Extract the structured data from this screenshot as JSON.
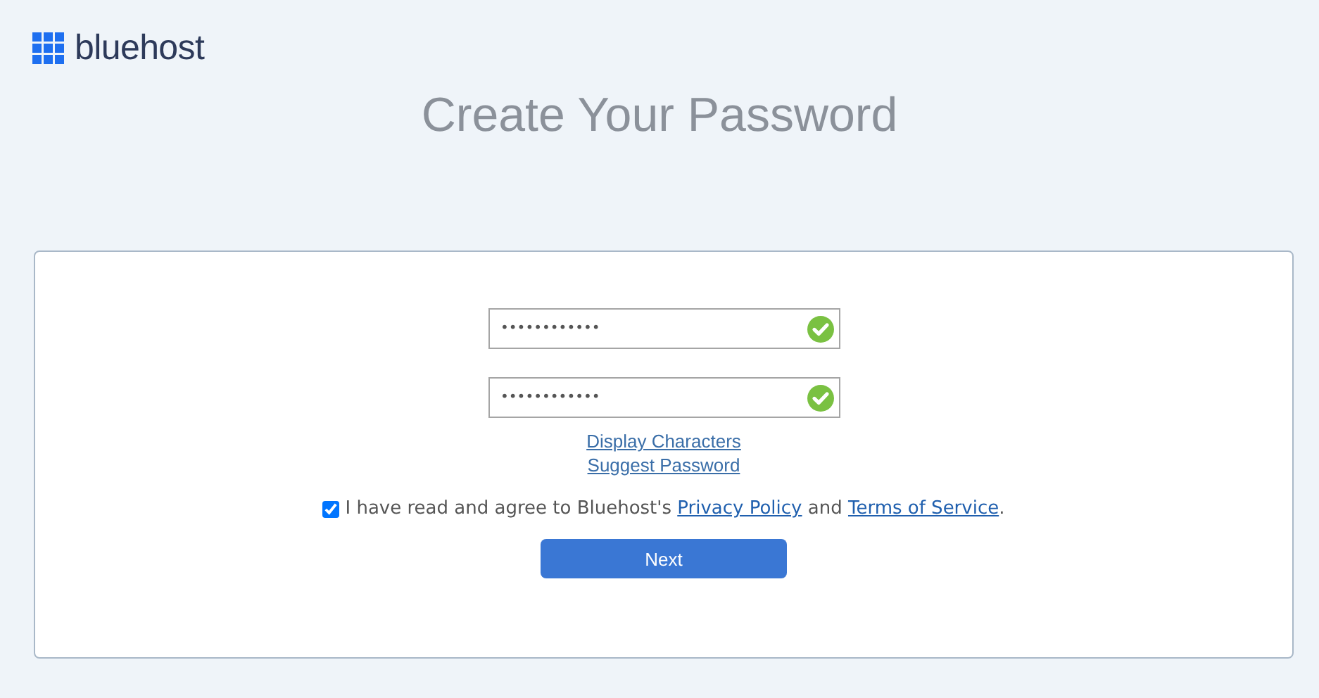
{
  "logo": {
    "text": "bluehost"
  },
  "title": "Create Your Password",
  "fields": [
    {
      "value": "••••••••••••",
      "valid": true
    },
    {
      "value": "••••••••••••",
      "valid": true
    }
  ],
  "links": [
    "Display Characters",
    "Suggest Password"
  ],
  "agreement": {
    "checked": true,
    "parts": [
      {
        "kind": "text",
        "text": "I have read and agree to Bluehost's "
      },
      {
        "kind": "link",
        "text": "Privacy Policy"
      },
      {
        "kind": "text",
        "text": " and "
      },
      {
        "kind": "link",
        "text": "Terms of Service"
      },
      {
        "kind": "text",
        "text": "."
      }
    ]
  },
  "button": "Next"
}
